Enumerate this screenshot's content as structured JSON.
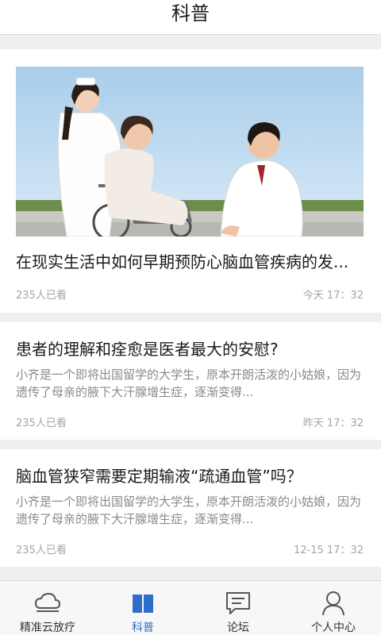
{
  "header": {
    "title": "科普"
  },
  "articles": [
    {
      "title": "在现实生活中如何早期预防心脑血管疾病的发...",
      "summary": "",
      "views": "235人已看",
      "time": "今天  17：32",
      "image": "nurse-doctor-patient-wheelchair-photo"
    },
    {
      "title": "患者的理解和痊愈是医者最大的安慰?",
      "summary": "小齐是一个即将出国留学的大学生，原本开朗活泼的小姑娘，因为遗传了母亲的腋下大汗腺增生症，逐渐变得...",
      "views": "235人已看",
      "time": "昨天  17：32"
    },
    {
      "title": "脑血管狭窄需要定期输液“疏通血管”吗？",
      "summary": "小齐是一个即将出国留学的大学生，原本开朗活泼的小姑娘，因为遗传了母亲的腋下大汗腺增生症，逐渐变得...",
      "views": "235人已看",
      "time": "12-15  17：32"
    }
  ],
  "tabs": [
    {
      "label": "精准云放疗",
      "icon": "cloud-icon",
      "active": false
    },
    {
      "label": "科普",
      "icon": "book-icon",
      "active": true
    },
    {
      "label": "论坛",
      "icon": "chat-icon",
      "active": false
    },
    {
      "label": "个人中心",
      "icon": "person-icon",
      "active": false
    }
  ],
  "colors": {
    "accent": "#2d6ec8",
    "background": "#efefef",
    "muted_text": "#a5a5a5"
  }
}
